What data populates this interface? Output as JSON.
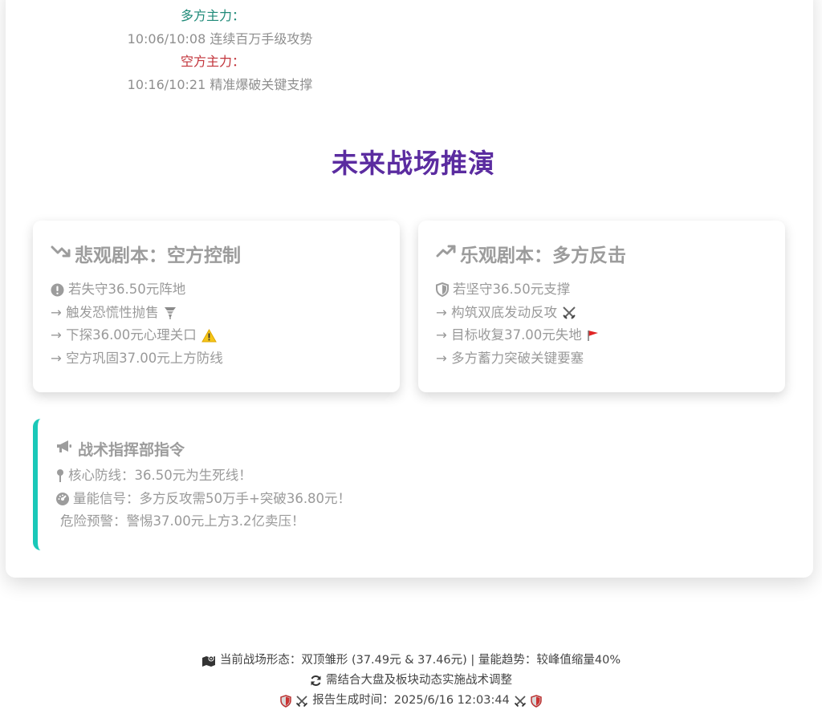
{
  "timeline": {
    "bull_label": "多方主力：",
    "bull_text": "10:06/10:08 连续百万手级攻势",
    "bear_label": "空方主力：",
    "bear_text": "10:16/10:21 精准爆破关键支撑"
  },
  "section_title": "未来战场推演",
  "scenarios": [
    {
      "title": "悲观剧本：空方控制",
      "icon": "trend-down-icon",
      "lines": [
        "若失守36.50元阵地",
        "→ 触发恐慌性抛售",
        "→ 下探36.00元心理关口",
        "→ 空方巩固37.00元上方防线"
      ]
    },
    {
      "title": "乐观剧本：多方反击",
      "icon": "trend-up-icon",
      "lines": [
        "若坚守36.50元支撑",
        "→ 构筑双底发动反攻",
        "→ 目标收复37.00元失地",
        "→ 多方蓄力突破关键要塞"
      ]
    }
  ],
  "command": {
    "title": "战术指挥部指令",
    "lines": [
      "核心防线：36.50元为生死线！",
      "量能信号：多方反攻需50万手+突破36.80元！",
      "危险预警：警惕37.00元上方3.2亿卖压！"
    ]
  },
  "footer": {
    "line1": "当前战场形态：双顶雏形 (37.49元 & 37.46元) | 量能趋势：较峰值缩量40%",
    "line2": "需结合大盘及板块动态实施战术调整",
    "line3": "报告生成时间：2025/6/16 12:03:44"
  },
  "colors": {
    "bull": "#1f8a78",
    "bear": "#c2343b",
    "title": "#5b2ca0",
    "accent_border": "#19c8b8"
  }
}
